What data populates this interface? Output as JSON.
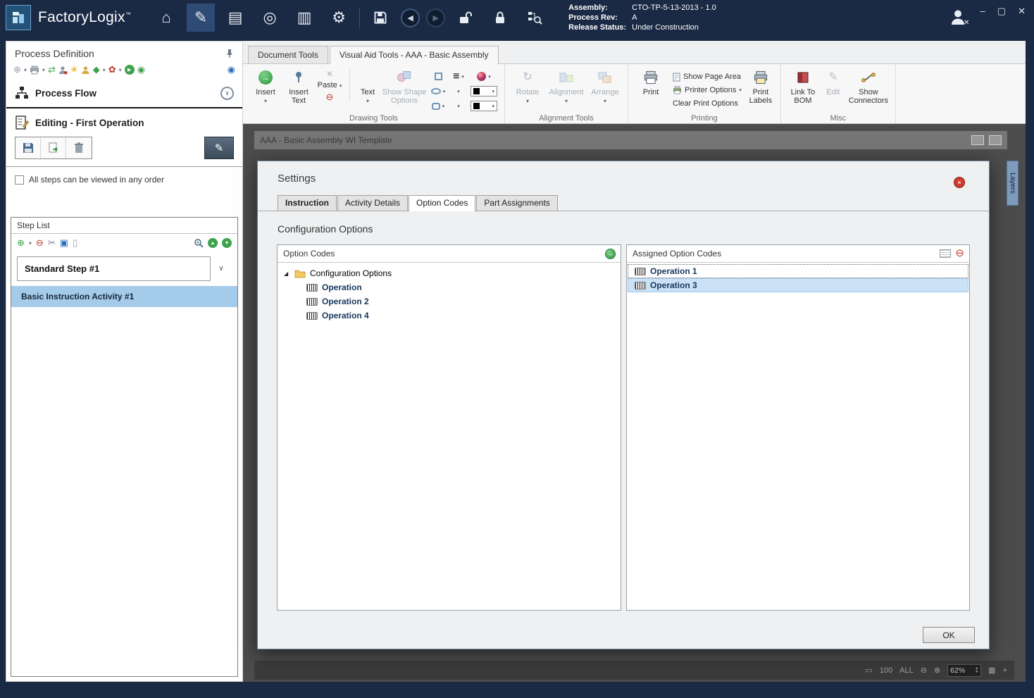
{
  "icons": {
    "dropdown": "▾",
    "chevron": "∨",
    "home": "⌂",
    "pencil": "✎",
    "book": "▤",
    "navigate": "◎",
    "news": "▥",
    "gear": "⚙",
    "back": "◀",
    "forward": "▶",
    "add_circle": "⊕",
    "remove_circle": "⊖",
    "cut": "✂",
    "copy": "▣",
    "paste_blank": "▯",
    "transfer": "⇄",
    "lamp": "✳",
    "package": "◆",
    "flower": "✿",
    "play": "▶",
    "record": "◉",
    "x_mark": "✕",
    "arrow_right": "→",
    "expander": "◢",
    "rotate": "↻",
    "lines": "≡",
    "fit_rect": "▭",
    "grid": "▦",
    "plus": "+",
    "up": "▲",
    "down": "▼",
    "win_min": "–",
    "win_max": "▢",
    "win_close": "✕"
  },
  "titlebar": {
    "app_name": "FactoryLogix",
    "trademark": "™",
    "info": {
      "assembly_label": "Assembly:",
      "assembly_value": "CTO-TP-5-13-2013 - 1.0",
      "process_rev_label": "Process Rev:",
      "process_rev_value": "A",
      "release_status_label": "Release Status:",
      "release_status_value": "Under Construction"
    }
  },
  "sidebar": {
    "title": "Process Definition",
    "process_flow_label": "Process Flow",
    "editing_title": "Editing - First Operation",
    "order_checkbox_label": "All steps can be viewed in any order",
    "step_list": {
      "title": "Step List",
      "step_name": "Standard Step #1",
      "activity_name": "Basic Instruction Activity #1"
    }
  },
  "ribbon": {
    "tabs": [
      "Document Tools",
      "Visual Aid Tools - AAA - Basic Assembly"
    ],
    "drawing": {
      "group_label": "Drawing Tools",
      "insert": "Insert",
      "insert_text": "Insert Text",
      "paste": "Paste",
      "text": "Text",
      "show_shape_options": "Show Shape Options"
    },
    "alignment": {
      "group_label": "Alignment Tools",
      "rotate": "Rotate",
      "alignment": "Alignment",
      "arrange": "Arrange"
    },
    "printing": {
      "group_label": "Printing",
      "print": "Print",
      "show_page_area": "Show Page Area",
      "printer_options": "Printer Options",
      "clear_print_options": "Clear Print Options",
      "print_labels": "Print Labels"
    },
    "misc": {
      "group_label": "Misc",
      "link_to_bom": "Link To BOM",
      "edit": "Edit",
      "show_connectors": "Show Connectors"
    }
  },
  "document": {
    "title": "AAA - Basic Assembly WI Template",
    "layers_tab": "Layers",
    "statusbar": {
      "hundred": "100",
      "all": "ALL",
      "zoom_value": "62%"
    }
  },
  "dialog": {
    "title": "Settings",
    "tabs": [
      "Instruction",
      "Activity Details",
      "Option Codes",
      "Part Assignments"
    ],
    "section_title": "Configuration Options",
    "option_codes": {
      "header": "Option Codes",
      "root": "Configuration Options",
      "items": [
        "Operation",
        "Operation 2",
        "Operation 4"
      ]
    },
    "assigned": {
      "header": "Assigned Option Codes",
      "items": [
        "Operation 1",
        "Operation 3"
      ]
    },
    "ok_label": "OK"
  }
}
